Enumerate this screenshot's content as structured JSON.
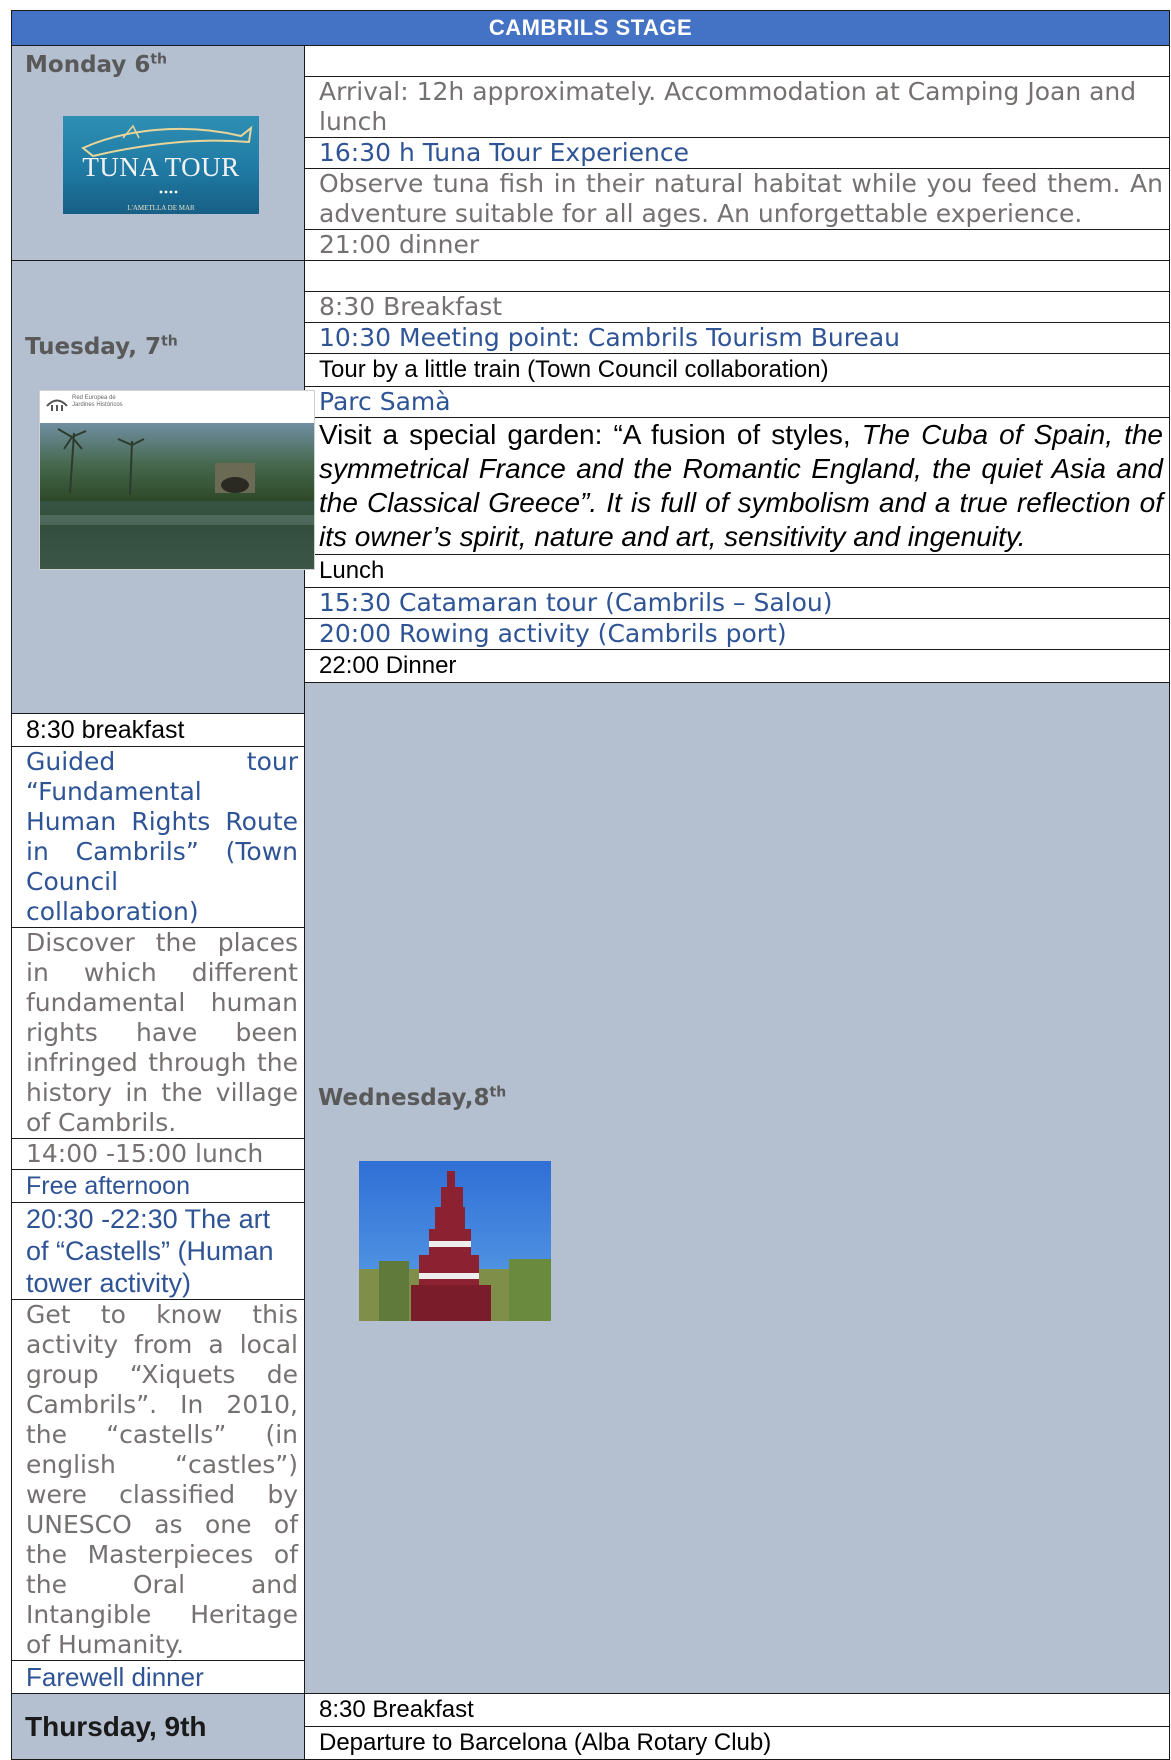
{
  "title": "CAMBRILS STAGE",
  "days": {
    "monday": {
      "label": "Monday 6",
      "sup": "th",
      "image_text": "TUNA TOUR",
      "image_subtext": "L'AMETLLA DE MAR",
      "rows": {
        "arrival": "Arrival: 12h approximately. Accommodation at Camping Joan and lunch",
        "tuna_title": "16:30 h Tuna Tour Experience",
        "tuna_desc": "Observe tuna fish in their natural habitat while you feed them. An adventure suitable for all ages. An unforgettable experience.",
        "dinner": "21:00 dinner"
      }
    },
    "tuesday": {
      "label": "Tuesday, 7",
      "sup": "th",
      "image_text_1": "Red Europea de",
      "image_text_2": "Jardines Históricos",
      "rows": {
        "breakfast": "8:30 Breakfast",
        "meeting": "10:30 Meeting point: Cambrils Tourism Bureau",
        "train": "Tour by a little train (Town Council collaboration)",
        "parc_title": "Parc Samà",
        "parc_desc_plain": "Visit a special garden: “A fusion of styles, ",
        "parc_desc_italic": "The Cuba of Spain, the symmetrical France and the Romantic England, the quiet Asia and the Classical Greece”. It is full of symbolism and a true reflection of its owner’s spirit, nature and art, sensitivity and ingenuity.",
        "lunch": "Lunch",
        "catamaran": "15:30 Catamaran tour (Cambrils – Salou)",
        "rowing": "20:00 Rowing activity (Cambrils port)",
        "dinner": "22:00 Dinner"
      }
    },
    "wednesday": {
      "label": "Wednesday,8",
      "sup": "th",
      "rows": {
        "breakfast": "8:30 breakfast",
        "guided_title": "Guided tour “Fundamental Human Rights Route in Cambrils” (Town Council collaboration)",
        "guided_desc": "Discover the places in which different fundamental human rights have been infringed through the history in the village of Cambrils.",
        "lunch": "14:00 -15:00 lunch",
        "free": "Free afternoon",
        "castells_title": "20:30 -22:30  The art of “Castells” (Human tower activity)",
        "castells_desc": "Get to know this activity from a local group “Xiquets de Cambrils”. In 2010, the “castells” (in english “castles”) were classified by UNESCO as one of the Masterpieces of the Oral and Intangible Heritage of Humanity.",
        "farewell": "Farewell dinner"
      }
    },
    "thursday": {
      "label": "Thursday, 9th",
      "rows": {
        "breakfast": "8:30 Breakfast",
        "departure": "Departure to Barcelona (Alba Rotary Club)"
      }
    }
  },
  "colors": {
    "header_bg": "#4472c4",
    "day_bg": "#b4bfcf",
    "gray_text": "#767171",
    "blue_text": "#2f5496"
  }
}
